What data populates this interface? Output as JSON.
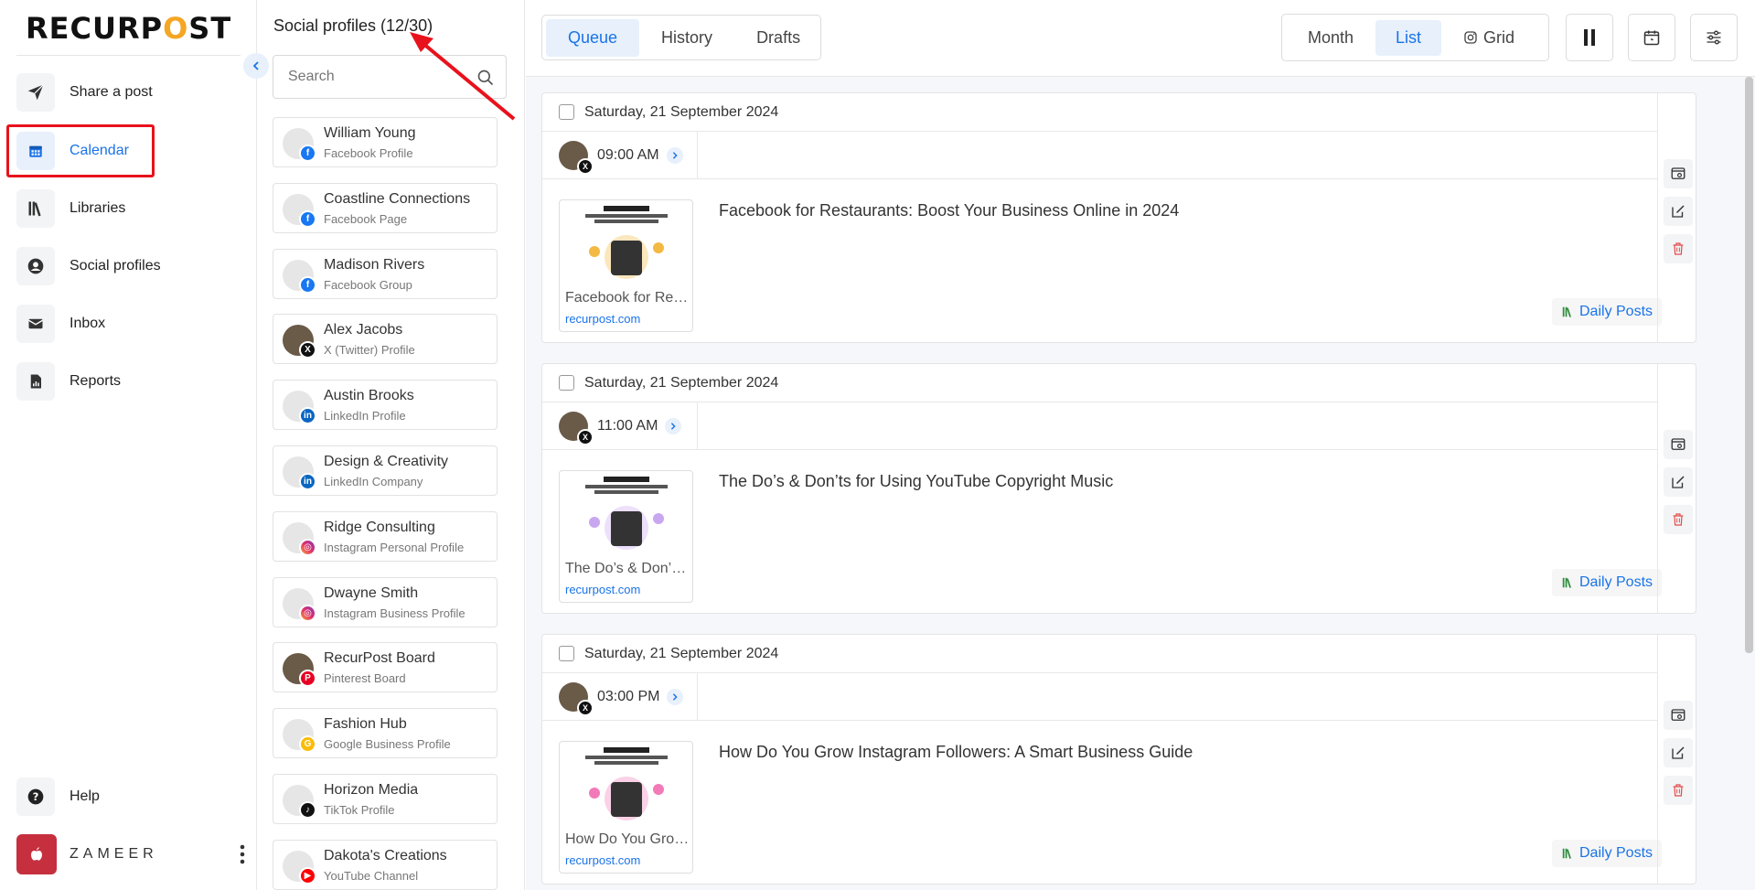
{
  "brand": {
    "logo_text_a": "RECURP",
    "logo_text_o": "O",
    "logo_text_b": "ST",
    "accent": "#1a73e8",
    "highlight": "#e8121c"
  },
  "sidebar": {
    "items": [
      {
        "label": "Share a post",
        "icon": "send-icon"
      },
      {
        "label": "Calendar",
        "icon": "calendar-icon",
        "active": true
      },
      {
        "label": "Libraries",
        "icon": "library-icon"
      },
      {
        "label": "Social profiles",
        "icon": "user-circle-icon"
      },
      {
        "label": "Inbox",
        "icon": "envelope-icon"
      },
      {
        "label": "Reports",
        "icon": "report-icon"
      }
    ],
    "help": "Help",
    "user": "ZAMEER"
  },
  "profiles_panel": {
    "title": "Social profiles (12/30)",
    "search_placeholder": "Search",
    "profiles": [
      {
        "name": "William Young",
        "type": "Facebook Profile",
        "network": "facebook"
      },
      {
        "name": "Coastline Connections",
        "type": "Facebook Page",
        "network": "facebook"
      },
      {
        "name": "Madison Rivers",
        "type": "Facebook Group",
        "network": "facebook"
      },
      {
        "name": "Alex Jacobs",
        "type": "X (Twitter) Profile",
        "network": "x"
      },
      {
        "name": "Austin Brooks",
        "type": "LinkedIn Profile",
        "network": "linkedin"
      },
      {
        "name": "Design & Creativity",
        "type": "LinkedIn Company",
        "network": "linkedin"
      },
      {
        "name": "Ridge Consulting",
        "type": "Instagram Personal Profile",
        "network": "instagram"
      },
      {
        "name": "Dwayne Smith",
        "type": "Instagram Business Profile",
        "network": "instagram"
      },
      {
        "name": "RecurPost Board",
        "type": "Pinterest Board",
        "network": "pinterest"
      },
      {
        "name": "Fashion Hub",
        "type": "Google Business Profile",
        "network": "google"
      },
      {
        "name": "Horizon Media",
        "type": "TikTok Profile",
        "network": "tiktok"
      },
      {
        "name": "Dakota's Creations",
        "type": "YouTube Channel",
        "network": "youtube"
      }
    ]
  },
  "toolbar": {
    "tabs": [
      "Queue",
      "History",
      "Drafts"
    ],
    "active_tab": "Queue",
    "views": [
      "Month",
      "List",
      "Grid"
    ],
    "active_view": "List"
  },
  "posts": [
    {
      "date": "Saturday, 21 September 2024",
      "time": "09:00 AM",
      "title": "Facebook for Restaurants: Boost Your Business Online in 2024",
      "thumb_title": "Facebook for Restaurants: Boost Your Business Online in 2024",
      "domain": "recurpost.com",
      "library": "Daily Posts"
    },
    {
      "date": "Saturday, 21 September 2024",
      "time": "11:00 AM",
      "title": "The Do’s & Don’ts for Using YouTube Copyright Music",
      "thumb_title": "The Do’s & Don’ts for Using YouTube Copyright Music",
      "domain": "recurpost.com",
      "library": "Daily Posts"
    },
    {
      "date": "Saturday, 21 September 2024",
      "time": "03:00 PM",
      "title": "How Do You Grow Instagram Followers: A Smart Business Guide",
      "thumb_title": "How Do You Grow Instagram Followers: A Smart Business Guide",
      "domain": "recurpost.com",
      "library": "Daily Posts"
    }
  ]
}
